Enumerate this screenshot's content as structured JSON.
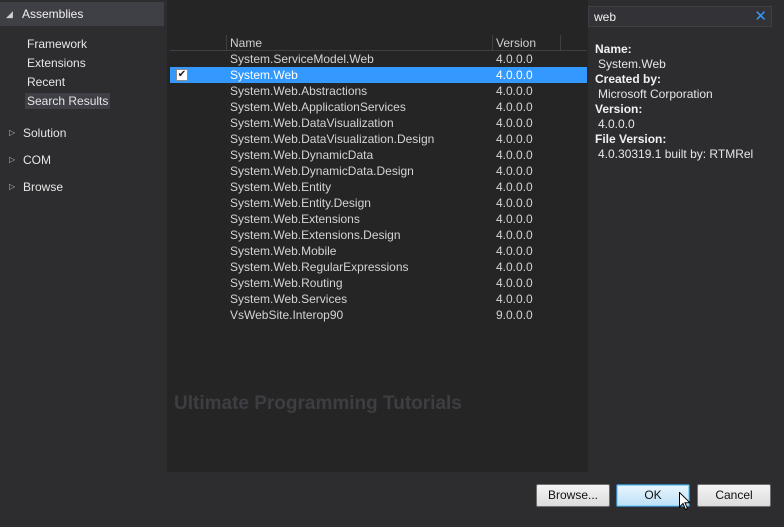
{
  "nav": {
    "header": "Assemblies",
    "sub_items": [
      {
        "label": "Framework",
        "selected": false
      },
      {
        "label": "Extensions",
        "selected": false
      },
      {
        "label": "Recent",
        "selected": false
      },
      {
        "label": "Search Results",
        "selected": true
      }
    ],
    "categories": [
      {
        "label": "Solution"
      },
      {
        "label": "COM"
      },
      {
        "label": "Browse"
      }
    ]
  },
  "list": {
    "columns": {
      "name": "Name",
      "version": "Version"
    },
    "rows": [
      {
        "name": "System.ServiceModel.Web",
        "version": "4.0.0.0",
        "checked": false,
        "selected": false
      },
      {
        "name": "System.Web",
        "version": "4.0.0.0",
        "checked": true,
        "selected": true
      },
      {
        "name": "System.Web.Abstractions",
        "version": "4.0.0.0",
        "checked": false,
        "selected": false
      },
      {
        "name": "System.Web.ApplicationServices",
        "version": "4.0.0.0",
        "checked": false,
        "selected": false
      },
      {
        "name": "System.Web.DataVisualization",
        "version": "4.0.0.0",
        "checked": false,
        "selected": false
      },
      {
        "name": "System.Web.DataVisualization.Design",
        "version": "4.0.0.0",
        "checked": false,
        "selected": false
      },
      {
        "name": "System.Web.DynamicData",
        "version": "4.0.0.0",
        "checked": false,
        "selected": false
      },
      {
        "name": "System.Web.DynamicData.Design",
        "version": "4.0.0.0",
        "checked": false,
        "selected": false
      },
      {
        "name": "System.Web.Entity",
        "version": "4.0.0.0",
        "checked": false,
        "selected": false
      },
      {
        "name": "System.Web.Entity.Design",
        "version": "4.0.0.0",
        "checked": false,
        "selected": false
      },
      {
        "name": "System.Web.Extensions",
        "version": "4.0.0.0",
        "checked": false,
        "selected": false
      },
      {
        "name": "System.Web.Extensions.Design",
        "version": "4.0.0.0",
        "checked": false,
        "selected": false
      },
      {
        "name": "System.Web.Mobile",
        "version": "4.0.0.0",
        "checked": false,
        "selected": false
      },
      {
        "name": "System.Web.RegularExpressions",
        "version": "4.0.0.0",
        "checked": false,
        "selected": false
      },
      {
        "name": "System.Web.Routing",
        "version": "4.0.0.0",
        "checked": false,
        "selected": false
      },
      {
        "name": "System.Web.Services",
        "version": "4.0.0.0",
        "checked": false,
        "selected": false
      },
      {
        "name": "VsWebSite.Interop90",
        "version": "9.0.0.0",
        "checked": false,
        "selected": false
      }
    ],
    "watermark": "Ultimate Programming Tutorials"
  },
  "search": {
    "value": "web",
    "clear_icon": "close-icon"
  },
  "details": [
    {
      "label": "Name:",
      "value": "System.Web"
    },
    {
      "label": "Created by:",
      "value": "Microsoft Corporation"
    },
    {
      "label": "Version:",
      "value": "4.0.0.0"
    },
    {
      "label": "File Version:",
      "value": "4.0.30319.1 built by: RTMRel"
    }
  ],
  "buttons": {
    "browse": "Browse...",
    "ok": "OK",
    "cancel": "Cancel"
  },
  "colors": {
    "selection": "#3399ff",
    "background": "#252526",
    "panel": "#2d2d30"
  }
}
